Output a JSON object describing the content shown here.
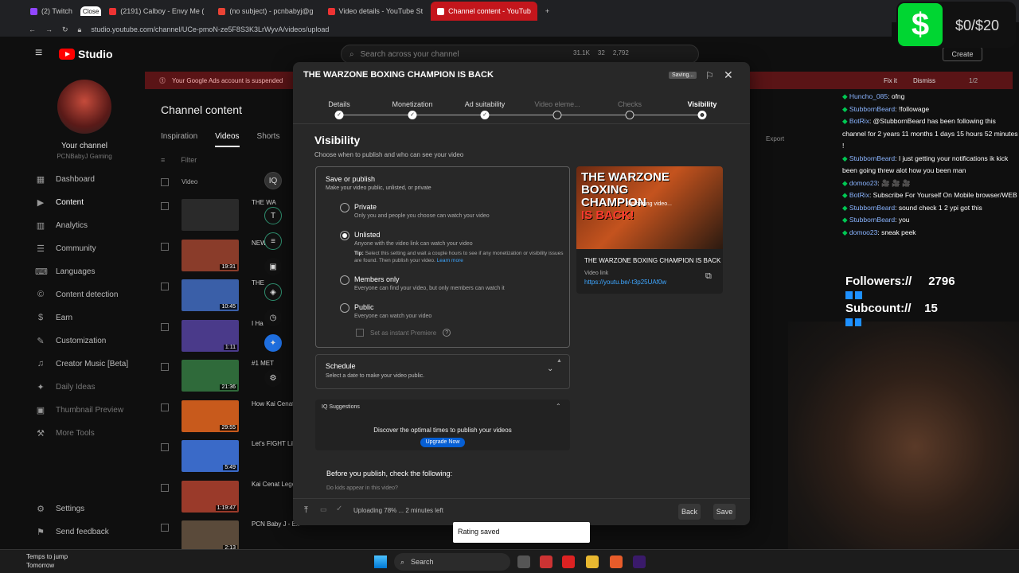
{
  "browser": {
    "tabs": [
      {
        "label": "(2) Twitch",
        "type": "tw"
      },
      {
        "label": "Close",
        "type": "tooltip"
      },
      {
        "label": "(2191) Calboy - Envy Me (",
        "type": "yt"
      },
      {
        "label": "(no subject) - pcnbabyj@g",
        "type": "gm"
      },
      {
        "label": "Video details - YouTube St",
        "type": "yt"
      },
      {
        "label": "Channel content - YouTub",
        "type": "yt",
        "active": true
      }
    ],
    "url": "studio.youtube.com/channel/UCe-pmoN-ze5F8S3K3LrWyvA/videos/upload"
  },
  "header": {
    "logo": "Studio",
    "search_placeholder": "Search across your channel",
    "stats": [
      "31.1K",
      "32",
      "2,792"
    ],
    "create_label": "Create"
  },
  "sidebar": {
    "your_channel": "Your channel",
    "handle": "PCNBabyJ Gaming",
    "items": [
      {
        "label": "Dashboard",
        "icon": "dashboard-icon",
        "glyph": "▦"
      },
      {
        "label": "Content",
        "icon": "content-icon",
        "glyph": "▶",
        "active": true
      },
      {
        "label": "Analytics",
        "icon": "analytics-icon",
        "glyph": "▥"
      },
      {
        "label": "Community",
        "icon": "community-icon",
        "glyph": "☰"
      },
      {
        "label": "Languages",
        "icon": "languages-icon",
        "glyph": "⌨"
      },
      {
        "label": "Content detection",
        "icon": "content-detection-icon",
        "glyph": "©"
      },
      {
        "label": "Earn",
        "icon": "earn-icon",
        "glyph": "$"
      },
      {
        "label": "Customization",
        "icon": "customization-icon",
        "glyph": "✎"
      },
      {
        "label": "Creator Music [Beta]",
        "icon": "music-icon",
        "glyph": "♫"
      },
      {
        "label": "Daily Ideas",
        "icon": "ideas-icon",
        "glyph": "✦",
        "dim": true
      },
      {
        "label": "Thumbnail Preview",
        "icon": "thumbnail-icon",
        "glyph": "▣",
        "dim": true
      },
      {
        "label": "More Tools",
        "icon": "tools-icon",
        "glyph": "⚒",
        "dim": true
      }
    ],
    "settings": "Settings",
    "feedback": "Send feedback"
  },
  "content_page": {
    "banner": "Your Google Ads account is suspended",
    "banner_fix": "Fix it",
    "banner_dismiss": "Dismiss",
    "banner_page": "1/2",
    "title": "Channel content",
    "tabs": [
      "Inspiration",
      "Videos",
      "Shorts"
    ],
    "filter": "Filter",
    "column_video": "Video",
    "export": "Export",
    "rows": [
      {
        "title": "THE WA",
        "duration": "",
        "color": "#2a2a2a"
      },
      {
        "title": "NEW",
        "duration": "19:31",
        "color": "#8a3c2a"
      },
      {
        "title": "THE",
        "duration": "10:45",
        "color": "#3a5fa8"
      },
      {
        "title": "I Ha",
        "duration": "1:11",
        "color": "#4a3a8a"
      },
      {
        "title": "#1 MET",
        "duration": "21:36",
        "color": "#2f6a3a"
      },
      {
        "title": "How Kai Cenat",
        "duration": "29:55",
        "color": "#c85a1c"
      },
      {
        "title": "Let's FIGHT Like",
        "duration": "5:49",
        "color": "#3a6ac8"
      },
      {
        "title": "Kai Cenat Legen",
        "duration": "1:19:47",
        "color": "#9a3a2a"
      },
      {
        "title": "PCN Baby J - Ex's",
        "duration": "2:13",
        "color": "#5a4a3a"
      }
    ]
  },
  "modal": {
    "title": "THE WARZONE BOXING CHAMPION IS BACK",
    "saving": "Saving...",
    "steps": [
      {
        "label": "Details",
        "state": "done"
      },
      {
        "label": "Monetization",
        "state": "done"
      },
      {
        "label": "Ad suitability",
        "state": "done"
      },
      {
        "label": "Video eleme...",
        "state": "future"
      },
      {
        "label": "Checks",
        "state": "future"
      },
      {
        "label": "Visibility",
        "state": "current"
      }
    ],
    "visibility_heading": "Visibility",
    "visibility_sub": "Choose when to publish and who can see your video",
    "save_publish_title": "Save or publish",
    "save_publish_sub": "Make your video public, unlisted, or private",
    "options": [
      {
        "label": "Private",
        "desc": "Only you and people you choose can watch your video",
        "selected": false
      },
      {
        "label": "Unlisted",
        "desc": "Anyone with the video link can watch your video",
        "selected": true,
        "tip_label": "Tip:",
        "tip": "Select this setting and wait a couple hours to see if any monetization or visibility issues are found. Then publish your video.",
        "learn_more": "Learn more"
      },
      {
        "label": "Members only",
        "desc": "Everyone can find your video, but only members can watch it",
        "selected": false
      },
      {
        "label": "Public",
        "desc": "Everyone can watch your video",
        "selected": false
      }
    ],
    "premiere": "Set as instant Premiere",
    "schedule_title": "Schedule",
    "schedule_sub": "Select a date to make your video public.",
    "suggestions_title": "Suggestions",
    "suggestions_text": "Discover the optimal times to publish your videos",
    "upgrade": "Upgrade Now",
    "precheck_title": "Before you publish, check the following:",
    "precheck_sub": "Do kids appear in this video?",
    "preview": {
      "thumb_line1": "THE WARZONE BOXING",
      "thumb_line2": "CHAMPION",
      "thumb_line3": "IS BACK!",
      "uploading": "Uploading video...",
      "title": "THE WARZONE BOXING CHAMPION IS BACK",
      "link_label": "Video link",
      "link": "https://youtu.be/-t3p25UAf0w"
    },
    "upload_status": "Uploading 78% ... 2 minutes left",
    "back": "Back",
    "save": "Save"
  },
  "toast": "Rating saved",
  "overlay": {
    "donation": "$0/$20",
    "chat": [
      {
        "user": "Huncho_085",
        "msg": ": ofng"
      },
      {
        "user": "StubbornBeard",
        "msg": ": !followage"
      },
      {
        "user": "BotRix",
        "msg": ": @StubbornBeard has been following this channel for 2 years 11 months 1 days 15 hours 52 minutes !"
      },
      {
        "user": "StubbornBeard",
        "msg": ": I just getting your notifications ik kick been going threw alot how you been man"
      },
      {
        "user": "domoo23",
        "msg": ": 🎥 🎥 🎥"
      },
      {
        "user": "BotRix",
        "msg": ": Subscribe For Yourself On Mobile browser/WEB"
      },
      {
        "user": "StubbornBeard",
        "msg": ": sound check 1 2 ypi got this"
      },
      {
        "user": "StubbornBeard",
        "msg": ": you"
      },
      {
        "user": "domoo23",
        "msg": ": sneak peek"
      }
    ],
    "followers_label": "Followers://",
    "followers_value": "2796",
    "subcount_label": "Subcount://",
    "subcount_value": "15"
  },
  "taskbar": {
    "weather_line1": "Temps to jump",
    "weather_line2": "Tomorrow",
    "search": "Search"
  }
}
